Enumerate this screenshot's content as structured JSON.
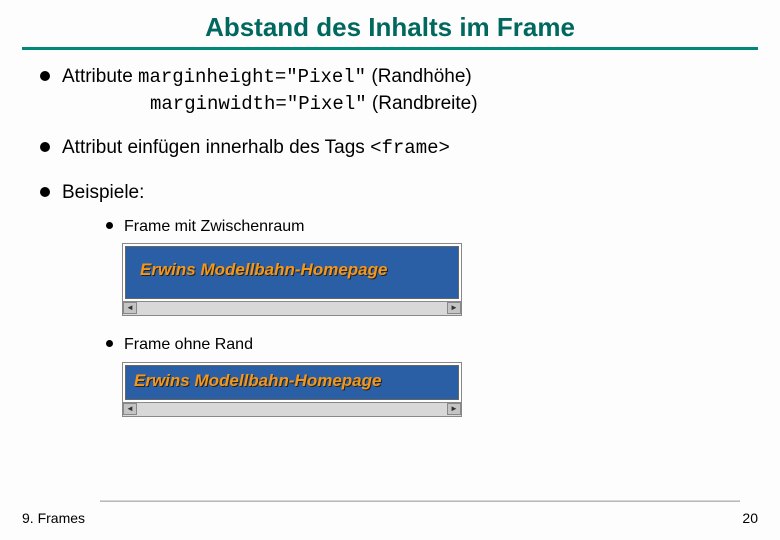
{
  "title": "Abstand des Inhalts im Frame",
  "bullets": {
    "b1_prefix": "Attribute ",
    "b1_code1": "marginheight=\"Pixel\"",
    "b1_suffix1": " (Randhöhe)",
    "b1_code2": "marginwidth=\"Pixel\"",
    "b1_suffix2": " (Randbreite)",
    "b2_prefix": "Attribut einfügen innerhalb des Tags ",
    "b2_code": "<frame>",
    "b3": "Beispiele:",
    "sub1": "Frame mit Zwischenraum",
    "sub2": "Frame ohne Rand"
  },
  "banner_text": "Erwins Modellbahn-Homepage",
  "footer": {
    "chapter": "9. Frames",
    "page": "20"
  }
}
